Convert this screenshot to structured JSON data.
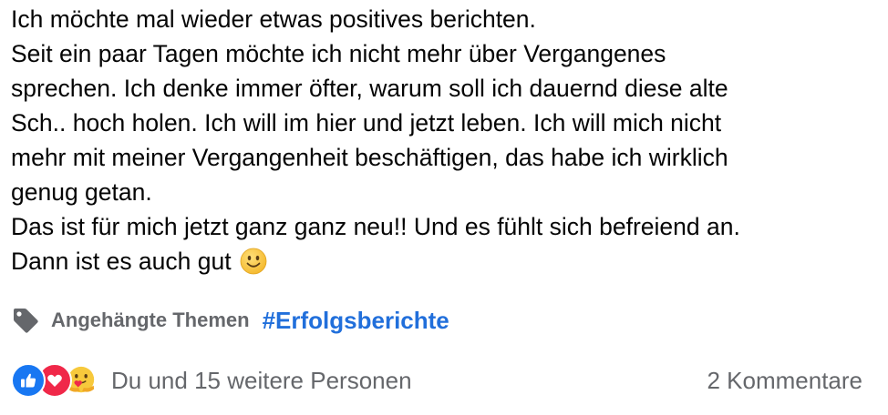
{
  "post": {
    "lines": [
      "Ich möchte mal wieder etwas positives berichten.",
      "Seit ein paar Tagen möchte ich nicht mehr über Vergangenes",
      "sprechen. Ich denke immer öfter, warum soll ich dauernd diese alte",
      "Sch.. hoch holen. Ich will im hier und jetzt leben. Ich will mich nicht",
      "mehr mit meiner Vergangenheit beschäftigen, das habe ich wirklich",
      "genug getan.",
      "Das ist für mich jetzt ganz ganz neu!! Und es fühlt sich befreiend an.",
      "Dann ist es auch gut"
    ],
    "emoji": "slightly-smiling-face-icon"
  },
  "topics": {
    "icon": "tag-icon",
    "label": "Angehängte Themen",
    "hashtag": "#Erfolgsberichte"
  },
  "footer": {
    "reaction_icons": [
      "like-icon",
      "love-icon",
      "care-icon"
    ],
    "reactions_text": "Du und 15 weitere Personen",
    "comments_text": "2 Kommentare"
  },
  "colors": {
    "text": "#050505",
    "secondary": "#65676b",
    "link": "#216fdb",
    "like": "#1877f2",
    "love": "#f02849",
    "emoji_yellow": "#f7c93c"
  }
}
